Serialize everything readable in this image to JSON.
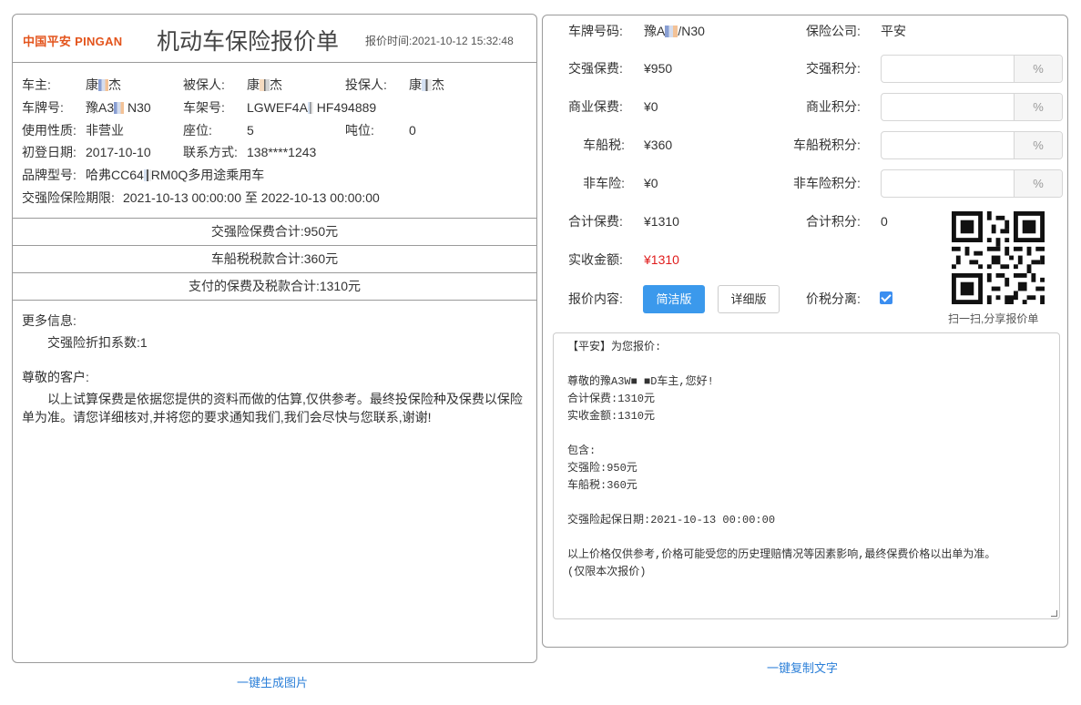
{
  "left": {
    "logo": "中国平安 PINGAN",
    "title": "机动车保险报价单",
    "quote_time_label": "报价时间:",
    "quote_time": "2021-10-12 15:32:48",
    "owner_label": "车主:",
    "owner_value": "康",
    "owner_tail": "杰",
    "insured_label": "被保人:",
    "insured_value": "康",
    "insured_tail": "杰",
    "applicant_label": "投保人:",
    "applicant_value": "康",
    "applicant_tail": "杰",
    "plate_label": "车牌号:",
    "plate_value": "豫A3",
    "plate_tail": "N30",
    "vin_label": "车架号:",
    "vin_value": "LGWEF4A",
    "vin_tail": "HF494889",
    "usage_label": "使用性质:",
    "usage_value": "非营业",
    "seats_label": "座位:",
    "seats_value": "5",
    "tonnage_label": "吨位:",
    "tonnage_value": "0",
    "reg_date_label": "初登日期:",
    "reg_date_value": "2017-10-10",
    "contact_label": "联系方式:",
    "contact_value": "138****1243",
    "model_label": "品牌型号:",
    "model_value": "哈弗CC64",
    "model_tail": "RM0Q多用途乘用车",
    "period_label": "交强险保险期限:",
    "period_value": "2021-10-13 00:00:00 至 2022-10-13 00:00:00",
    "sum_compulsory": "交强险保费合计:950元",
    "sum_vessel_tax": "车船税税款合计:360元",
    "sum_total": "支付的保费及税款合计:1310元",
    "more_title": "更多信息:",
    "discount_label": "交强险折扣系数:",
    "discount_value": "1",
    "dear_customer": "尊敬的客户:",
    "disclaimer": "以上试算保费是依据您提供的资料而做的估算,仅供参考。最终投保险种及保费以保险单为准。请您详细核对,并将您的要求通知我们,我们会尽快与您联系,谢谢!",
    "generate_image_link": "一键生成图片"
  },
  "right": {
    "plate_label": "车牌号码:",
    "plate_value": "豫A",
    "plate_tail": "/N30",
    "company_label": "保险公司:",
    "company_value": "平安",
    "compulsory_label": "交强保费:",
    "compulsory_value": "¥950",
    "compulsory_points_label": "交强积分:",
    "commercial_label": "商业保费:",
    "commercial_value": "¥0",
    "commercial_points_label": "商业积分:",
    "vessel_tax_label": "车船税:",
    "vessel_tax_value": "¥360",
    "vessel_tax_points_label": "车船税积分:",
    "non_auto_label": "非车险:",
    "non_auto_value": "¥0",
    "non_auto_points_label": "非车险积分:",
    "total_label": "合计保费:",
    "total_value": "¥1310",
    "total_points_label": "合计积分:",
    "total_points_value": "0",
    "actual_label": "实收金额:",
    "actual_value": "¥1310",
    "content_label": "报价内容:",
    "simple_button": "简洁版",
    "detail_button": "详细版",
    "tax_split_label": "价税分离:",
    "percent_suffix": "%",
    "qr_caption": "扫一扫,分享报价单",
    "textarea_text": "【平安】为您报价:\n\n尊敬的豫A3W■ ■D车主,您好!\n合计保费:1310元\n实收金额:1310元\n\n包含:\n交强险:950元\n车船税:360元\n\n交强险起保日期:2021-10-13 00:00:00\n\n以上价格仅供参考,价格可能受您的历史理赔情况等因素影响,最终保费价格以出单为准。\n(仅限本次报价)",
    "copy_text_link": "一键复制文字"
  },
  "colors": {
    "accent": "#3b99ec",
    "brand": "#e3541c",
    "alert": "#e01c1c",
    "link": "#2b7fd8"
  }
}
